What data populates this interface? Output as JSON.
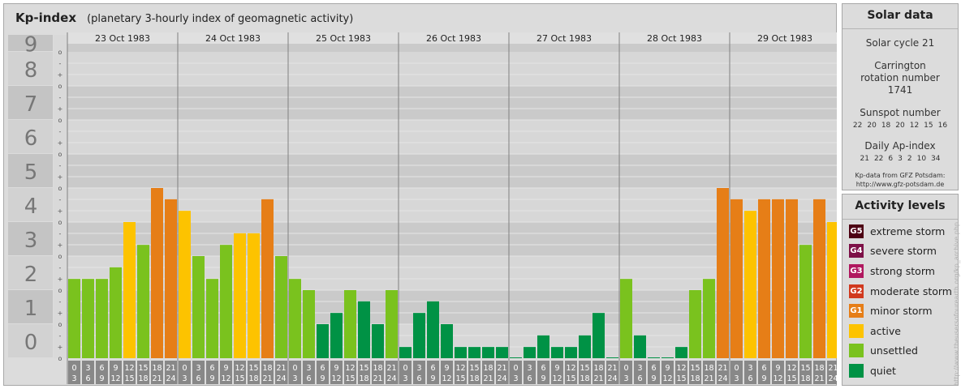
{
  "header": {
    "title": "Kp-index",
    "subtitle": "(planetary 3-hourly index of geomagnetic activity)"
  },
  "chart_data": {
    "type": "bar",
    "y_major_ticks": [
      "0",
      "1",
      "2",
      "3",
      "4",
      "5",
      "6",
      "7",
      "8",
      "9"
    ],
    "y_minor_ticks": [
      "o",
      "+",
      "-"
    ],
    "ylim": [
      0,
      9
    ],
    "days": [
      "23 Oct 1983",
      "24 Oct 1983",
      "25 Oct 1983",
      "26 Oct 1983",
      "27 Oct 1983",
      "28 Oct 1983",
      "29 Oct 1983"
    ],
    "hour_start": [
      "0",
      "3",
      "6",
      "9",
      "12",
      "15",
      "18",
      "21"
    ],
    "hour_end": [
      "3",
      "6",
      "9",
      "12",
      "15",
      "18",
      "21",
      "24"
    ],
    "values": [
      [
        2.33,
        2.33,
        2.33,
        2.67,
        4.0,
        3.33,
        5.0,
        4.67
      ],
      [
        4.33,
        3.0,
        2.33,
        3.33,
        3.67,
        3.67,
        4.67,
        3.0
      ],
      [
        2.33,
        2.0,
        1.0,
        1.33,
        2.0,
        1.67,
        1.0,
        2.0
      ],
      [
        0.33,
        1.33,
        1.67,
        1.0,
        0.33,
        0.33,
        0.33,
        0.33
      ],
      [
        0.0,
        0.33,
        0.67,
        0.33,
        0.33,
        0.67,
        1.33,
        0.0
      ],
      [
        2.33,
        0.67,
        0.0,
        0.0,
        0.33,
        2.0,
        2.33,
        5.0
      ],
      [
        4.67,
        4.33,
        4.67,
        4.67,
        4.67,
        3.33,
        4.67,
        4.0
      ]
    ],
    "colors": {
      "quiet": "#009245",
      "unsettled": "#7ac21e",
      "active": "#fdc300",
      "minor_storm": "#e67e17",
      "moderate_storm": "#d1391e",
      "strong_storm": "#b0185f",
      "severe_storm": "#7d1047",
      "extreme_storm": "#4d0013"
    },
    "grid": true
  },
  "solar": {
    "heading": "Solar data",
    "cycle": "Solar cycle 21",
    "carrington": "Carrington rotation number 1741",
    "sunspot_label": "Sunspot number",
    "sunspot_values": [
      "22",
      "20",
      "18",
      "20",
      "12",
      "15",
      "16"
    ],
    "ap_label": "Daily Ap-index",
    "ap_values": [
      "21",
      "22",
      "6",
      "3",
      "2",
      "10",
      "34"
    ],
    "credit_line1": "Kp-data from GFZ Potsdam:",
    "credit_line2": "http://www.gfz-potsdam.de"
  },
  "activity": {
    "heading": "Activity levels",
    "levels": [
      {
        "badge": "G5",
        "label": "extreme storm",
        "color": "#4d0013"
      },
      {
        "badge": "G4",
        "label": "severe storm",
        "color": "#7d1047"
      },
      {
        "badge": "G3",
        "label": "strong storm",
        "color": "#b0185f"
      },
      {
        "badge": "G2",
        "label": "moderate storm",
        "color": "#d1391e"
      },
      {
        "badge": "G1",
        "label": "minor storm",
        "color": "#e67e17"
      },
      {
        "badge": "",
        "label": "active",
        "color": "#fdc300"
      },
      {
        "badge": "",
        "label": "unsettled",
        "color": "#7ac21e"
      },
      {
        "badge": "",
        "label": "quiet",
        "color": "#009245"
      }
    ]
  },
  "watermark": "http://www.theusersofourearth.org/kp_archive.php"
}
